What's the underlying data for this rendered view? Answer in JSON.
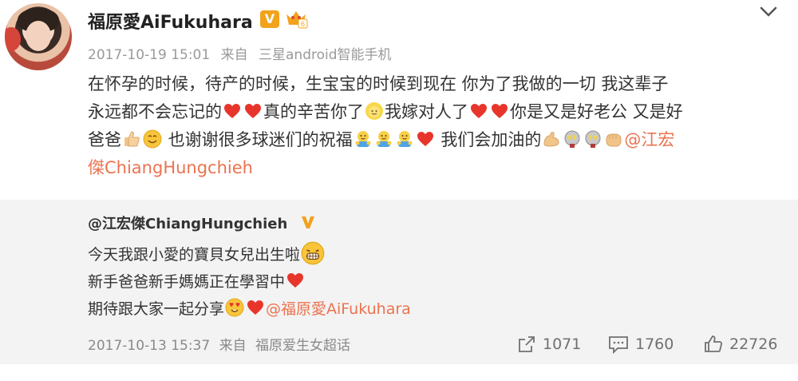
{
  "post": {
    "author": "福原愛AiFukuhara",
    "vip_badge": "V",
    "timestamp": "2017-10-19 15:01",
    "source_prefix": "来自",
    "source": "三星android智能手机",
    "lines": {
      "l1": "在怀孕的时候，待产的时候，生宝宝的时候到现在 你为了我做的一切 我这辈子",
      "l2a": "永远都不会忘记的",
      "l2b": "真的辛苦你了",
      "l2c": "我嫁对人了",
      "l2d": "你是又是好老公 又是好",
      "l3a": "爸爸",
      "l3b": " 也谢谢很多球迷们的祝福",
      "l3c": " 我们会加油的",
      "l3mention": "@江宏",
      "l4mention": "傑ChiangHungchieh"
    }
  },
  "repost": {
    "author": "@江宏傑ChiangHungchieh",
    "lines": {
      "r1": "今天我跟小愛的寶貝女兒出生啦",
      "r2": "新手爸爸新手媽媽正在學習中",
      "r3": "期待跟大家一起分享",
      "r3mention": "@福原愛AiFukuhara"
    },
    "timestamp": "2017-10-13 15:37",
    "source_prefix": "来自",
    "source": "福原爱生女超话",
    "reposts": "1071",
    "comments": "1760",
    "likes": "22726"
  },
  "colors": {
    "link": "#eb7350",
    "vip": "#f2a21b",
    "heart": "#e8352c"
  }
}
